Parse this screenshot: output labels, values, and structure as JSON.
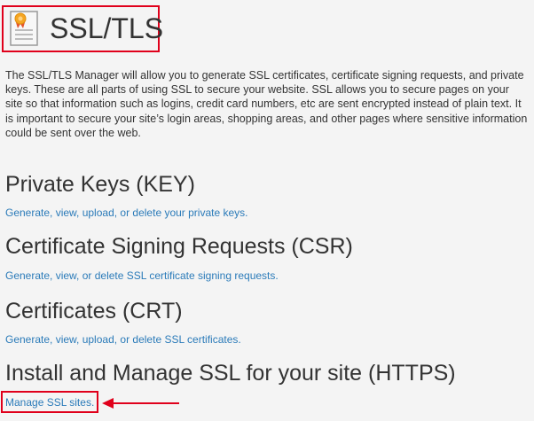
{
  "header": {
    "title": "SSL/TLS",
    "icon": "ssl-certificate-icon"
  },
  "description": "The SSL/TLS Manager will allow you to generate SSL certificates, certificate signing requests, and private keys. These are all parts of using SSL to secure your website. SSL allows you to secure pages on your site so that information such as logins, credit card numbers, etc are sent encrypted instead of plain text. It is important to secure your site’s login areas, shopping areas, and other pages where sensitive information could be sent over the web.",
  "sections": [
    {
      "heading": "Private Keys (KEY)",
      "link": "Generate, view, upload, or delete your private keys."
    },
    {
      "heading": "Certificate Signing Requests (CSR)",
      "link": "Generate, view, or delete SSL certificate signing requests."
    },
    {
      "heading": "Certificates (CRT)",
      "link": "Generate, view, upload, or delete SSL certificates."
    },
    {
      "heading": "Install and Manage SSL for your site (HTTPS)",
      "link": "Manage SSL sites."
    }
  ],
  "colors": {
    "link": "#2b7bb9",
    "highlight": "#e0001b",
    "text": "#333333",
    "background": "#f4f4f4"
  }
}
